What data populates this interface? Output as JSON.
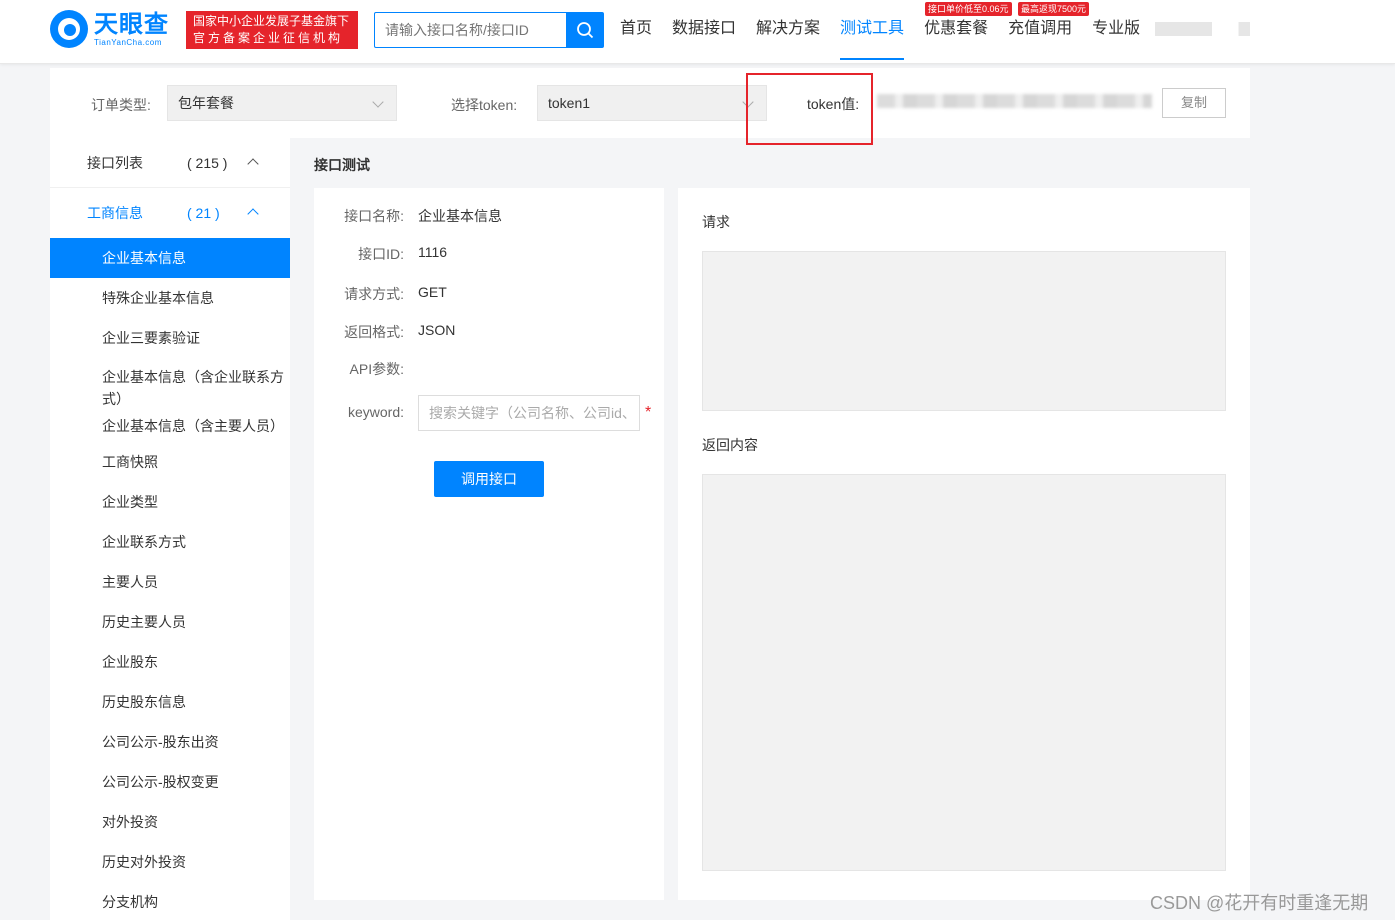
{
  "header": {
    "logo_cn": "天眼查",
    "logo_en": "TianYanCha.com",
    "badge_line1": "国家中小企业发展子基金旗下",
    "badge_line2": "官方备案企业征信机构",
    "search_placeholder": "请输入接口名称/接口ID",
    "nav": [
      "首页",
      "数据接口",
      "解决方案",
      "测试工具",
      "优惠套餐",
      "充值调用",
      "专业版"
    ],
    "nav_active": "测试工具",
    "tag1": "接口单价低至0.06元",
    "tag2": "最高返现7500元"
  },
  "filter": {
    "order_type_label": "订单类型:",
    "order_type_value": "包年套餐",
    "token_label": "选择token:",
    "token_value": "token1",
    "token_value_label": "token值:",
    "copy_label": "复制"
  },
  "sidebar": {
    "group1_label": "接口列表",
    "group1_count": "( 215 )",
    "group2_label": "工商信息",
    "group2_count": "( 21 )",
    "items": [
      "企业基本信息",
      "特殊企业基本信息",
      "企业三要素验证",
      "企业基本信息（含企业联系方式）",
      "企业基本信息（含主要人员）",
      "工商快照",
      "企业类型",
      "企业联系方式",
      "主要人员",
      "历史主要人员",
      "企业股东",
      "历史股东信息",
      "公司公示-股东出资",
      "公司公示-股权变更",
      "对外投资",
      "历史对外投资",
      "分支机构"
    ]
  },
  "main": {
    "section_title": "接口测试",
    "name_label": "接口名称:",
    "name_value": "企业基本信息",
    "id_label": "接口ID:",
    "id_value": "1116",
    "method_label": "请求方式:",
    "method_value": "GET",
    "format_label": "返回格式:",
    "format_value": "JSON",
    "params_label": "API参数:",
    "keyword_label": "keyword:",
    "keyword_placeholder": "搜索关键字（公司名称、公司id、",
    "required_mark": "*",
    "call_button": "调用接口",
    "request_label": "请求",
    "response_label": "返回内容"
  },
  "watermark": "CSDN @花开有时重逢无期",
  "colors": {
    "brand": "#0084ff",
    "red": "#e5242b"
  }
}
